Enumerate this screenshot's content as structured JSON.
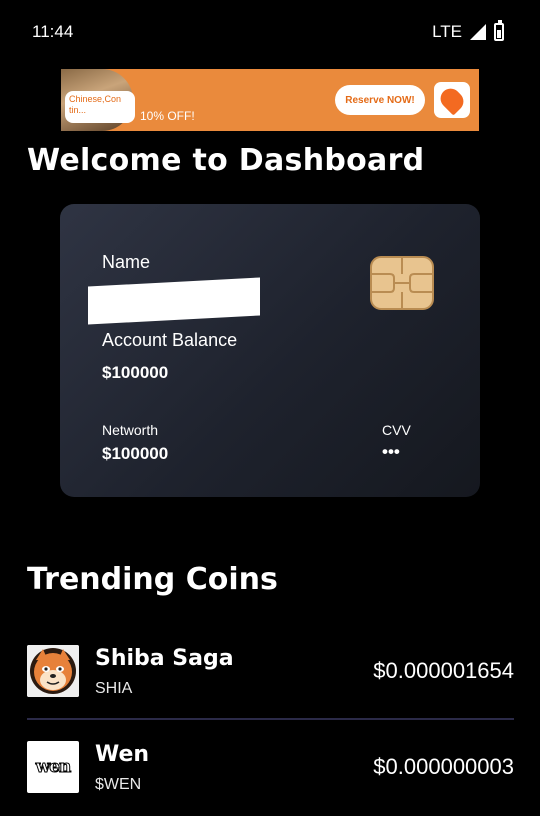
{
  "status_bar": {
    "time": "11:44",
    "network": "LTE"
  },
  "ad": {
    "tag": "Chinese,Con tin...",
    "offer": "10% OFF!",
    "cta": "Reserve NOW!",
    "brand_color": "#ea8a3c"
  },
  "dashboard": {
    "title": "Welcome to Dashboard"
  },
  "card": {
    "name_label": "Name",
    "balance_label": "Account Balance",
    "balance_value": "$100000",
    "networth_label": "Networth",
    "networth_value": "$100000",
    "cvv_label": "CVV",
    "cvv_value": "•••"
  },
  "trending": {
    "title": "Trending Coins",
    "coins": [
      {
        "name": "Shiba Saga",
        "symbol": "SHIA",
        "price": "$0.000001654",
        "icon": "shiba-icon"
      },
      {
        "name": "Wen",
        "symbol": "$WEN",
        "price": "$0.000000003",
        "icon": "wen-icon",
        "icon_text": "wen"
      }
    ]
  }
}
